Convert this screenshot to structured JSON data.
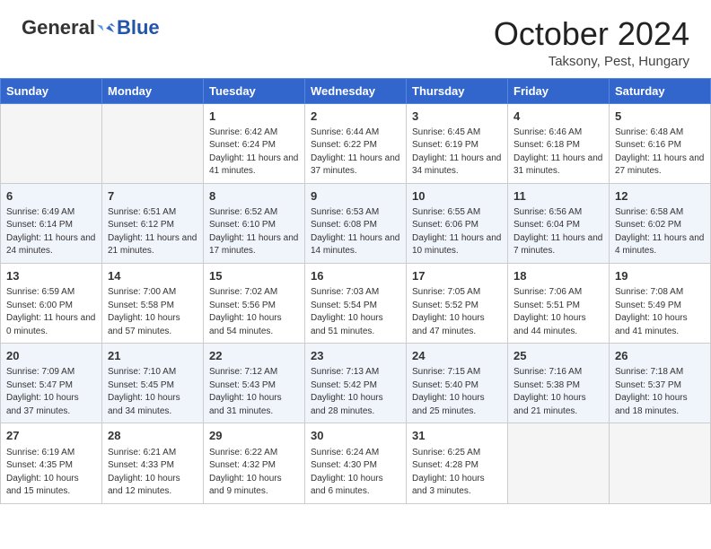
{
  "header": {
    "logo_general": "General",
    "logo_blue": "Blue",
    "month_title": "October 2024",
    "location": "Taksony, Pest, Hungary"
  },
  "days_of_week": [
    "Sunday",
    "Monday",
    "Tuesday",
    "Wednesday",
    "Thursday",
    "Friday",
    "Saturday"
  ],
  "weeks": [
    [
      {
        "day": "",
        "info": ""
      },
      {
        "day": "",
        "info": ""
      },
      {
        "day": "1",
        "info": "Sunrise: 6:42 AM\nSunset: 6:24 PM\nDaylight: 11 hours and 41 minutes."
      },
      {
        "day": "2",
        "info": "Sunrise: 6:44 AM\nSunset: 6:22 PM\nDaylight: 11 hours and 37 minutes."
      },
      {
        "day": "3",
        "info": "Sunrise: 6:45 AM\nSunset: 6:19 PM\nDaylight: 11 hours and 34 minutes."
      },
      {
        "day": "4",
        "info": "Sunrise: 6:46 AM\nSunset: 6:18 PM\nDaylight: 11 hours and 31 minutes."
      },
      {
        "day": "5",
        "info": "Sunrise: 6:48 AM\nSunset: 6:16 PM\nDaylight: 11 hours and 27 minutes."
      }
    ],
    [
      {
        "day": "6",
        "info": "Sunrise: 6:49 AM\nSunset: 6:14 PM\nDaylight: 11 hours and 24 minutes."
      },
      {
        "day": "7",
        "info": "Sunrise: 6:51 AM\nSunset: 6:12 PM\nDaylight: 11 hours and 21 minutes."
      },
      {
        "day": "8",
        "info": "Sunrise: 6:52 AM\nSunset: 6:10 PM\nDaylight: 11 hours and 17 minutes."
      },
      {
        "day": "9",
        "info": "Sunrise: 6:53 AM\nSunset: 6:08 PM\nDaylight: 11 hours and 14 minutes."
      },
      {
        "day": "10",
        "info": "Sunrise: 6:55 AM\nSunset: 6:06 PM\nDaylight: 11 hours and 10 minutes."
      },
      {
        "day": "11",
        "info": "Sunrise: 6:56 AM\nSunset: 6:04 PM\nDaylight: 11 hours and 7 minutes."
      },
      {
        "day": "12",
        "info": "Sunrise: 6:58 AM\nSunset: 6:02 PM\nDaylight: 11 hours and 4 minutes."
      }
    ],
    [
      {
        "day": "13",
        "info": "Sunrise: 6:59 AM\nSunset: 6:00 PM\nDaylight: 11 hours and 0 minutes."
      },
      {
        "day": "14",
        "info": "Sunrise: 7:00 AM\nSunset: 5:58 PM\nDaylight: 10 hours and 57 minutes."
      },
      {
        "day": "15",
        "info": "Sunrise: 7:02 AM\nSunset: 5:56 PM\nDaylight: 10 hours and 54 minutes."
      },
      {
        "day": "16",
        "info": "Sunrise: 7:03 AM\nSunset: 5:54 PM\nDaylight: 10 hours and 51 minutes."
      },
      {
        "day": "17",
        "info": "Sunrise: 7:05 AM\nSunset: 5:52 PM\nDaylight: 10 hours and 47 minutes."
      },
      {
        "day": "18",
        "info": "Sunrise: 7:06 AM\nSunset: 5:51 PM\nDaylight: 10 hours and 44 minutes."
      },
      {
        "day": "19",
        "info": "Sunrise: 7:08 AM\nSunset: 5:49 PM\nDaylight: 10 hours and 41 minutes."
      }
    ],
    [
      {
        "day": "20",
        "info": "Sunrise: 7:09 AM\nSunset: 5:47 PM\nDaylight: 10 hours and 37 minutes."
      },
      {
        "day": "21",
        "info": "Sunrise: 7:10 AM\nSunset: 5:45 PM\nDaylight: 10 hours and 34 minutes."
      },
      {
        "day": "22",
        "info": "Sunrise: 7:12 AM\nSunset: 5:43 PM\nDaylight: 10 hours and 31 minutes."
      },
      {
        "day": "23",
        "info": "Sunrise: 7:13 AM\nSunset: 5:42 PM\nDaylight: 10 hours and 28 minutes."
      },
      {
        "day": "24",
        "info": "Sunrise: 7:15 AM\nSunset: 5:40 PM\nDaylight: 10 hours and 25 minutes."
      },
      {
        "day": "25",
        "info": "Sunrise: 7:16 AM\nSunset: 5:38 PM\nDaylight: 10 hours and 21 minutes."
      },
      {
        "day": "26",
        "info": "Sunrise: 7:18 AM\nSunset: 5:37 PM\nDaylight: 10 hours and 18 minutes."
      }
    ],
    [
      {
        "day": "27",
        "info": "Sunrise: 6:19 AM\nSunset: 4:35 PM\nDaylight: 10 hours and 15 minutes."
      },
      {
        "day": "28",
        "info": "Sunrise: 6:21 AM\nSunset: 4:33 PM\nDaylight: 10 hours and 12 minutes."
      },
      {
        "day": "29",
        "info": "Sunrise: 6:22 AM\nSunset: 4:32 PM\nDaylight: 10 hours and 9 minutes."
      },
      {
        "day": "30",
        "info": "Sunrise: 6:24 AM\nSunset: 4:30 PM\nDaylight: 10 hours and 6 minutes."
      },
      {
        "day": "31",
        "info": "Sunrise: 6:25 AM\nSunset: 4:28 PM\nDaylight: 10 hours and 3 minutes."
      },
      {
        "day": "",
        "info": ""
      },
      {
        "day": "",
        "info": ""
      }
    ]
  ]
}
